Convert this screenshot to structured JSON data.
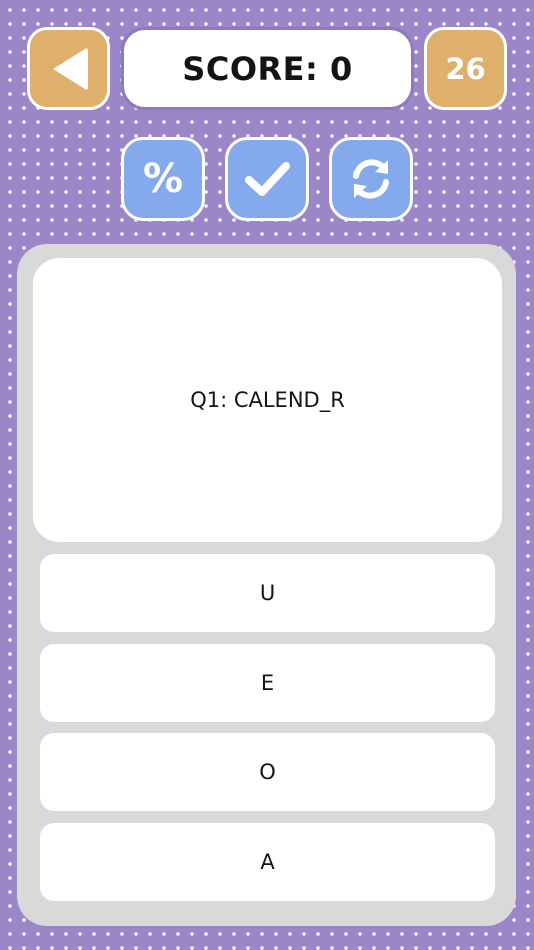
{
  "header": {
    "back_icon": "triangle-left-icon",
    "score_label": "SCORE: 0",
    "remaining_count": "26"
  },
  "tools": [
    {
      "icon": "percent-icon",
      "glyph": "%"
    },
    {
      "icon": "checkmark-icon"
    },
    {
      "icon": "refresh-icon"
    }
  ],
  "question": {
    "text": "Q1: CALEND_R"
  },
  "answers": [
    {
      "label": "U"
    },
    {
      "label": "E"
    },
    {
      "label": "O"
    },
    {
      "label": "A"
    }
  ],
  "colors": {
    "background": "#9b86c8",
    "orange_button": "#deb06c",
    "blue_button": "#84a9ec",
    "panel": "#d9d9d9",
    "card": "#ffffff"
  }
}
